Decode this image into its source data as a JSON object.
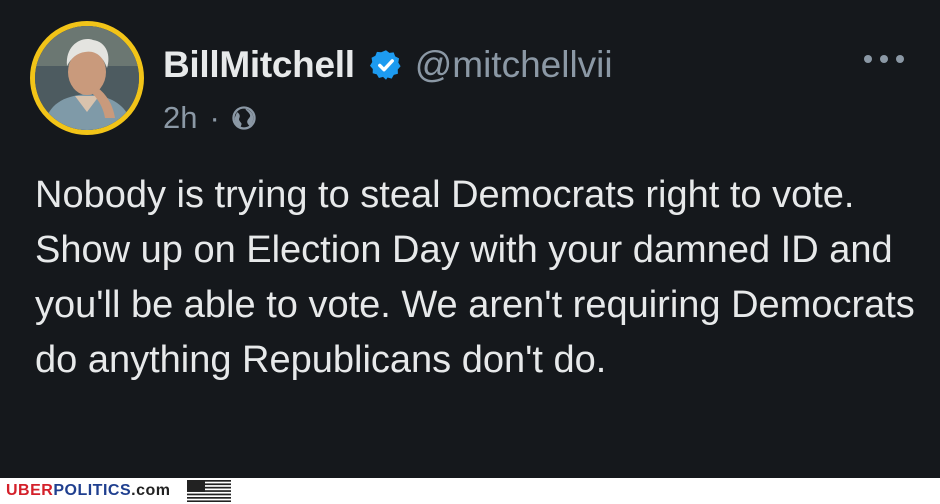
{
  "tweet": {
    "display_name": "BillMitchell",
    "handle": "@mitchellvii",
    "time": "2h",
    "separator": "·",
    "text": "Nobody is trying to steal Democrats right to vote. Show up on Election Day with your damned ID and you'll be able to vote. We aren't requiring Democrats do anything Republicans don't do."
  },
  "icons": {
    "verified": "verified-badge-icon",
    "audience": "globe-icon",
    "more": "more-options-icon"
  },
  "watermark": {
    "part1": "UBER",
    "part2": "POLITICS",
    "part3": ".com"
  },
  "colors": {
    "background": "#15181c",
    "avatar_ring": "#f2c418",
    "verified_blue": "#1d9bf0",
    "muted_text": "#8b98a5",
    "primary_text": "#e7e9ea"
  }
}
